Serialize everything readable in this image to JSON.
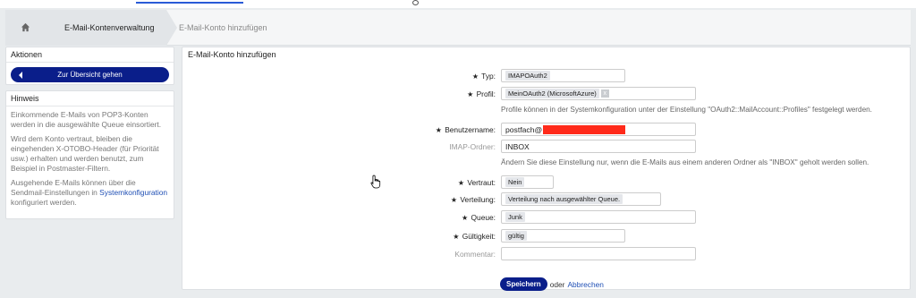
{
  "breadcrumb": {
    "level1": "E-Mail-Kontenverwaltung",
    "level2": "E-Mail-Konto hinzufügen"
  },
  "sidebar": {
    "actions_title": "Aktionen",
    "overview_button": "Zur Übersicht gehen",
    "hint_title": "Hinweis",
    "hint_p1": "Einkommende E-Mails von POP3-Konten werden in die ausgewählte Queue einsortiert.",
    "hint_p2": "Wird dem Konto vertraut, bleiben die eingehenden X-OTOBO-Header (für Priorität usw.) erhalten und werden benutzt, zum Beispiel in Postmaster-Filtern.",
    "hint_p3_pre": "Ausgehende E-Mails können über die Sendmail-Einstellungen in",
    "hint_p3_link": "Systemkonfiguration",
    "hint_p3_post": "konfiguriert werden."
  },
  "form": {
    "title": "E-Mail-Konto hinzufügen",
    "type_label": "Typ:",
    "type_value": "IMAPOAuth2",
    "profile_label": "Profil:",
    "profile_value": "MeinOAuth2 (MicrosoftAzure)",
    "profile_remove": "x",
    "profile_help": "Profile können in der Systemkonfiguration unter der Einstellung \"OAuth2::MailAccount::Profiles\" festgelegt werden.",
    "username_label": "Benutzername:",
    "username_value": "postfach@",
    "imap_folder_label": "IMAP-Ordner:",
    "imap_folder_value": "INBOX",
    "imap_folder_help": "Ändern Sie diese Einstellung nur, wenn die E-Mails aus einem anderen Ordner als \"INBOX\" geholt werden sollen.",
    "trusted_label": "Vertraut:",
    "trusted_value": "Nein",
    "dispatching_label": "Verteilung:",
    "dispatching_value": "Verteilung nach ausgewählter Queue.",
    "queue_label": "Queue:",
    "queue_value": "Junk",
    "validity_label": "Gültigkeit:",
    "validity_value": "gültig",
    "comment_label": "Kommentar:",
    "comment_value": "",
    "required_marker": "★",
    "save_button": "Speichern",
    "or_text": "oder",
    "cancel_link": "Abbrechen"
  },
  "icons": {
    "home": "home-icon",
    "back_arrow": "arrow-left-icon",
    "cursor": "hand-pointer-icon"
  },
  "colors": {
    "accent": "#0a1e8a",
    "link": "#1f4fb5",
    "redaction": "#ff2a1a"
  }
}
